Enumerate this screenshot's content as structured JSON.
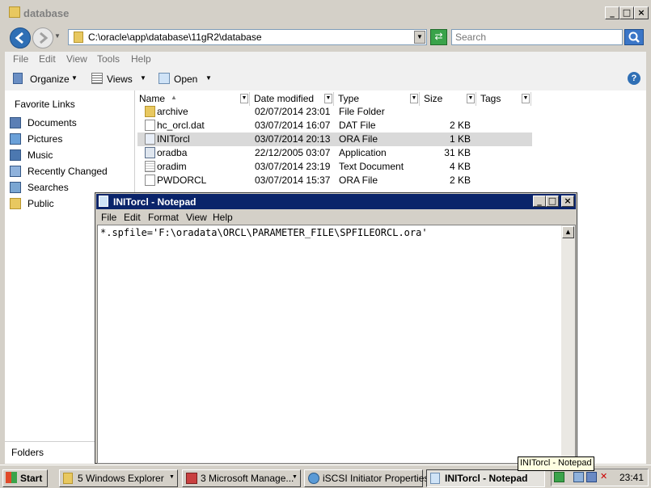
{
  "explorer": {
    "title": "database",
    "address": "C:\\oracle\\app\\database\\11gR2\\database",
    "search_placeholder": "Search",
    "menu": [
      "File",
      "Edit",
      "View",
      "Tools",
      "Help"
    ],
    "commands": {
      "organize": "Organize",
      "views": "Views",
      "open": "Open"
    },
    "favorite_links_title": "Favorite Links",
    "nav_items": [
      "Documents",
      "Pictures",
      "Music",
      "Recently Changed",
      "Searches",
      "Public"
    ],
    "folders_label": "Folders",
    "columns": [
      "Name",
      "Date modified",
      "Type",
      "Size",
      "Tags"
    ],
    "files": [
      {
        "name": "archive",
        "date": "02/07/2014 23:01",
        "type": "File Folder",
        "size": "",
        "icon": "folder-icon"
      },
      {
        "name": "hc_orcl.dat",
        "date": "03/07/2014 16:07",
        "type": "DAT File",
        "size": "2 KB",
        "icon": "file-icon"
      },
      {
        "name": "INITorcl",
        "date": "03/07/2014 20:13",
        "type": "ORA File",
        "size": "1 KB",
        "icon": "file-icon",
        "selected": true
      },
      {
        "name": "oradba",
        "date": "22/12/2005 03:07",
        "type": "Application",
        "size": "31 KB",
        "icon": "application-icon"
      },
      {
        "name": "oradim",
        "date": "03/07/2014 23:19",
        "type": "Text Document",
        "size": "4 KB",
        "icon": "text-file-icon"
      },
      {
        "name": "PWDORCL",
        "date": "03/07/2014 15:37",
        "type": "ORA File",
        "size": "2 KB",
        "icon": "file-icon"
      }
    ]
  },
  "notepad": {
    "title": "INITorcl - Notepad",
    "menu": [
      "File",
      "Edit",
      "Format",
      "View",
      "Help"
    ],
    "content": "*.spfile='F:\\oradata\\ORCL\\PARAMETER_FILE\\SPFILEORCL.ora'"
  },
  "taskbar": {
    "start": "Start",
    "buttons": [
      "5 Windows Explorer",
      "3 Microsoft Manage...",
      "iSCSI Initiator Properties",
      "INITorcl - Notepad"
    ],
    "tooltip": "INITorcl - Notepad",
    "clock": "23:41"
  },
  "colors": {
    "title_active": "#0a246a",
    "selection": "#d9d9d9",
    "taskbar": "#d4d0c8"
  }
}
